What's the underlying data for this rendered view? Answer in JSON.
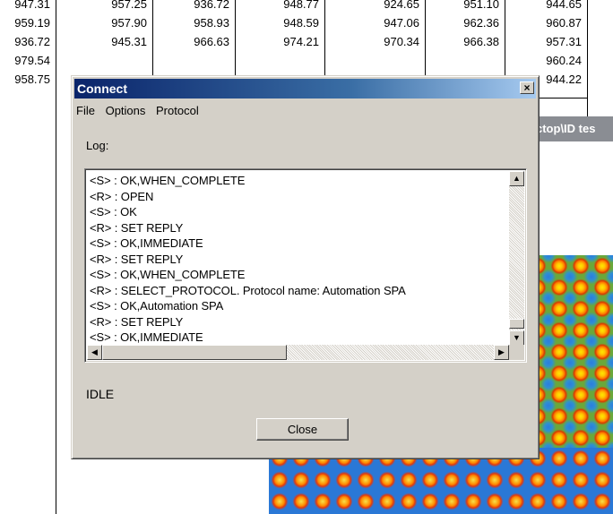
{
  "background_table": {
    "rows": [
      [
        "947.31",
        "957.25",
        "936.72",
        "948.77",
        "924.65",
        "951.10",
        "944.65"
      ],
      [
        "959.19",
        "957.90",
        "958.93",
        "948.59",
        "947.06",
        "962.36",
        "960.87"
      ],
      [
        "936.72",
        "945.31",
        "966.63",
        "974.21",
        "970.34",
        "966.38",
        "957.31"
      ],
      [
        "979.54",
        "",
        "",
        "",
        "",
        "",
        "960.24"
      ],
      [
        "958.75",
        "",
        "",
        "",
        "",
        "",
        "944.22"
      ]
    ]
  },
  "image_window": {
    "title_fragment": "ctop\\ID tes"
  },
  "dialog": {
    "title": "Connect",
    "close_glyph": "×",
    "menu": [
      "File",
      "Options",
      "Protocol"
    ],
    "log_label": "Log:",
    "log_lines": [
      "<S> : OK,WHEN_COMPLETE",
      "<R> : OPEN",
      "<S> : OK",
      "<R> : SET REPLY",
      "<S> : OK,IMMEDIATE",
      "<R> : SET REPLY",
      "<S> : OK,WHEN_COMPLETE",
      "<R> : SELECT_PROTOCOL. Protocol name: Automation SPA",
      "<S> : OK,Automation SPA",
      "<R> : SET REPLY",
      "<S> : OK,IMMEDIATE"
    ],
    "scroll_up_icon": "▲",
    "scroll_down_icon": "▼",
    "scroll_left_icon": "◀",
    "scroll_right_icon": "▶",
    "status": "IDLE",
    "close_label": "Close"
  }
}
